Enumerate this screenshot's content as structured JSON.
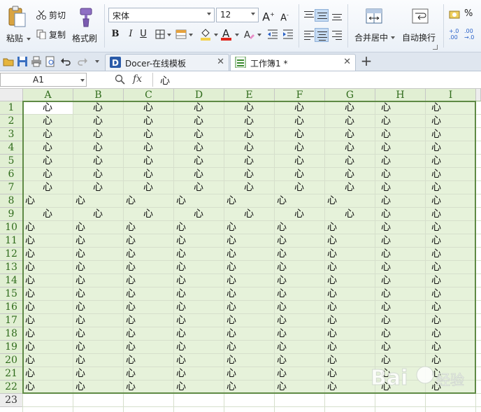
{
  "ribbon": {
    "cut": "剪切",
    "paste": "粘贴",
    "copy": "复制",
    "format_painter": "格式刷",
    "font_name": "宋体",
    "font_size": "12",
    "bold": "B",
    "italic": "I",
    "underline": "U",
    "grow_font": "A",
    "shrink_font": "A",
    "font_color_letter": "A",
    "merge_center": "合并居中",
    "wrap_text": "自动换行",
    "percent": "%"
  },
  "tabs": [
    {
      "label": "Docer-在线模板"
    },
    {
      "label": "工作簿1 *"
    }
  ],
  "formula_bar": {
    "name_box": "A1",
    "fx": "fx",
    "content": "心"
  },
  "sheet": {
    "columns": [
      "A",
      "B",
      "C",
      "D",
      "E",
      "F",
      "G",
      "H",
      "I"
    ],
    "rows": [
      "1",
      "2",
      "3",
      "4",
      "5",
      "6",
      "7",
      "8",
      "9",
      "10",
      "11",
      "12",
      "13",
      "14",
      "15",
      "16",
      "17",
      "18",
      "19",
      "20",
      "21",
      "22",
      "23"
    ],
    "cell_text": "心"
  },
  "colors": {
    "selection_fill": "#e6f2da",
    "header_selected": "#e1efd3",
    "selection_border": "#5f8a45"
  },
  "watermark": {
    "text": "Bai 经验"
  }
}
